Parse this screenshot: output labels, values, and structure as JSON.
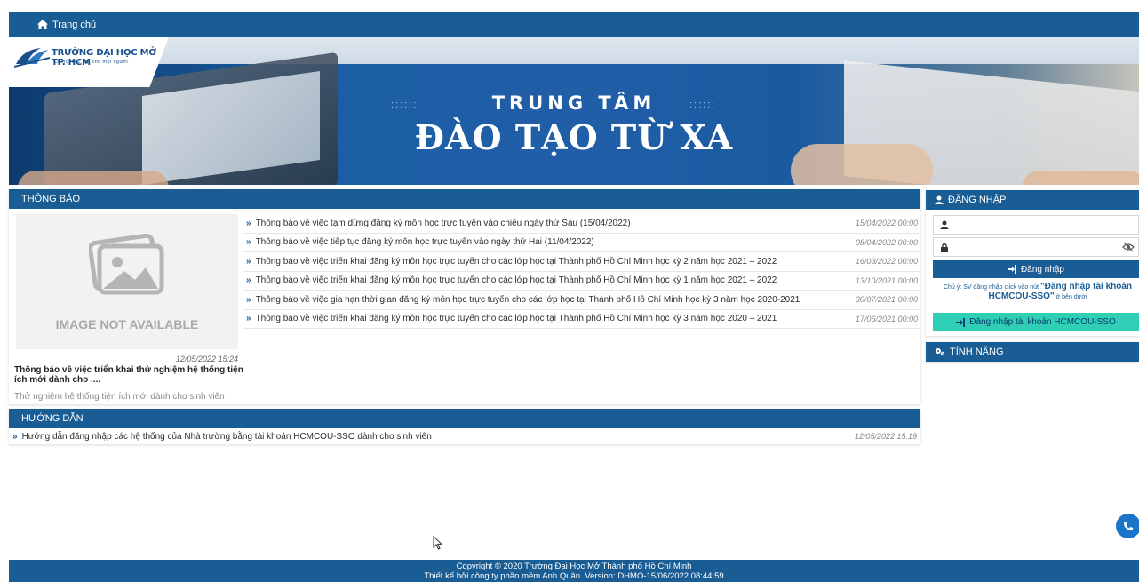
{
  "nav": {
    "home_label": "Trang chủ"
  },
  "banner": {
    "logo_name": "TRƯỜNG ĐẠI HỌC MỞ TP. HCM",
    "logo_slogan": "Cơ hội học tập cho mọi người",
    "title_top": "TRUNG TÂM",
    "title_main": "ĐÀO TẠO TỪ XA"
  },
  "notices": {
    "heading": "THÔNG BÁO",
    "featured": {
      "image_placeholder": "IMAGE NOT AVAILABLE",
      "date": "12/05/2022 15:24",
      "title": "Thông báo về việc triển khai thử nghiệm hệ thống tiện ích mới dành cho ....",
      "description": "Thử nghiệm hệ thống tiện ích mới dành cho sinh viên"
    },
    "items": [
      {
        "title": "Thông báo về việc tạm dừng đăng ký môn học trực tuyến vào chiều ngày thứ Sáu (15/04/2022)",
        "date": "15/04/2022 00:00"
      },
      {
        "title": "Thông báo về việc tiếp tục đăng ký môn học trực tuyến vào ngày thứ Hai (11/04/2022)",
        "date": "08/04/2022 00:00"
      },
      {
        "title": "Thông báo về việc triển khai đăng ký môn học trực tuyến cho các lớp học tại Thành phố Hồ Chí Minh học kỳ 2 năm học 2021 – 2022",
        "date": "16/03/2022 00:00"
      },
      {
        "title": "Thông báo về việc triển khai đăng ký môn học trực tuyến cho các lớp học tại Thành phố Hồ Chí Minh học kỳ 1 năm học 2021 – 2022",
        "date": "13/10/2021 00:00"
      },
      {
        "title": "Thông báo về việc gia hạn thời gian đăng ký môn học trực tuyến cho các lớp học tại Thành phố Hồ Chí Minh học kỳ 3 năm học 2020-2021",
        "date": "30/07/2021 00:00"
      },
      {
        "title": "Thông báo về việc triển khai đăng ký môn học trực tuyến cho các lớp học tại Thành phố Hồ Chí Minh học kỳ 3 năm học 2020 – 2021",
        "date": "17/06/2021 00:00"
      }
    ]
  },
  "guides": {
    "heading": "HƯỚNG DẪN",
    "items": [
      {
        "title": "Hướng dẫn đăng nhập các hệ thống của Nhà trường bằng tài khoản HCMCOU-SSO dành cho sinh viên",
        "date": "12/05/2022 15:19"
      }
    ]
  },
  "login": {
    "heading": "ĐĂNG NHẬP",
    "username_value": "",
    "password_value": "",
    "login_button": "Đăng nhập",
    "note_prefix": "Chú ý: SV đăng nhập click vào nút",
    "note_highlight": "\"Đăng nhập tài khoản HCMCOU-SSO\"",
    "note_suffix": "ở bên dưới",
    "sso_button": "Đăng nhập tài khoản HCMCOU-SSO"
  },
  "features": {
    "heading": "TÍNH NĂNG"
  },
  "footer": {
    "line1": "Copyright © 2020 Trường Đại Học Mở Thành phố Hồ Chí Minh",
    "line2": "Thiết kế bởi công ty phần mềm Anh Quân. Version: DHMO-15/06/2022 08:44:59"
  },
  "colors": {
    "primary": "#1a5c94",
    "sso": "#2ecfb5"
  }
}
